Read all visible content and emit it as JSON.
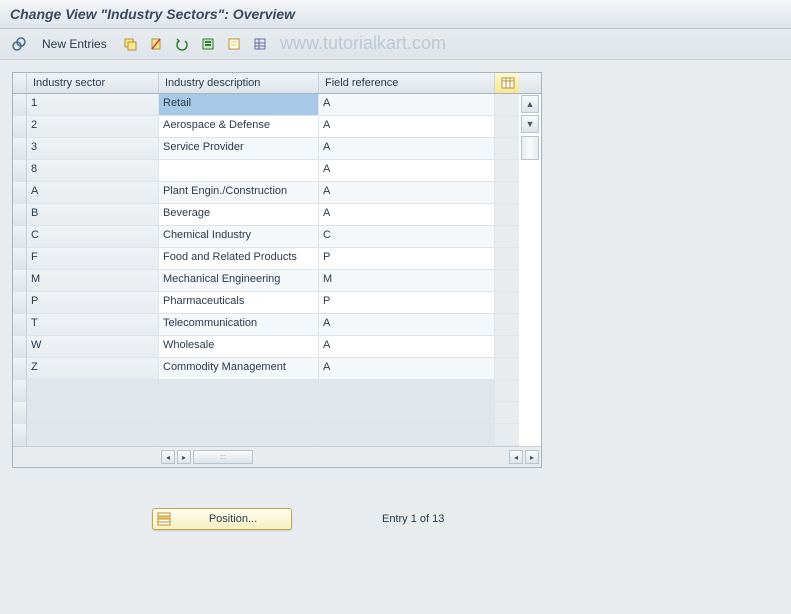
{
  "title": "Change View \"Industry Sectors\": Overview",
  "watermark": "www.tutorialkart.com",
  "toolbar": {
    "new_entries": "New Entries"
  },
  "table": {
    "headers": {
      "sector": "Industry sector",
      "description": "Industry description",
      "reference": "Field reference"
    },
    "rows": [
      {
        "sector": "1",
        "description": "Retail",
        "reference": "A",
        "selected": true
      },
      {
        "sector": "2",
        "description": "Aerospace & Defense",
        "reference": "A"
      },
      {
        "sector": "3",
        "description": "Service Provider",
        "reference": "A"
      },
      {
        "sector": "8",
        "description": "",
        "reference": "A"
      },
      {
        "sector": "A",
        "description": "Plant Engin./Construction",
        "reference": "A"
      },
      {
        "sector": "B",
        "description": "Beverage",
        "reference": "A"
      },
      {
        "sector": "C",
        "description": "Chemical Industry",
        "reference": "C"
      },
      {
        "sector": "F",
        "description": "Food and Related Products",
        "reference": "P"
      },
      {
        "sector": "M",
        "description": "Mechanical Engineering",
        "reference": "M"
      },
      {
        "sector": "P",
        "description": "Pharmaceuticals",
        "reference": "P"
      },
      {
        "sector": "T",
        "description": "Telecommunication",
        "reference": "A"
      },
      {
        "sector": "W",
        "description": "Wholesale",
        "reference": "A"
      },
      {
        "sector": "Z",
        "description": "Commodity Management",
        "reference": "A"
      }
    ],
    "empty_rows": 3
  },
  "footer": {
    "position_button": "Position...",
    "entry_status": "Entry 1 of 13"
  }
}
